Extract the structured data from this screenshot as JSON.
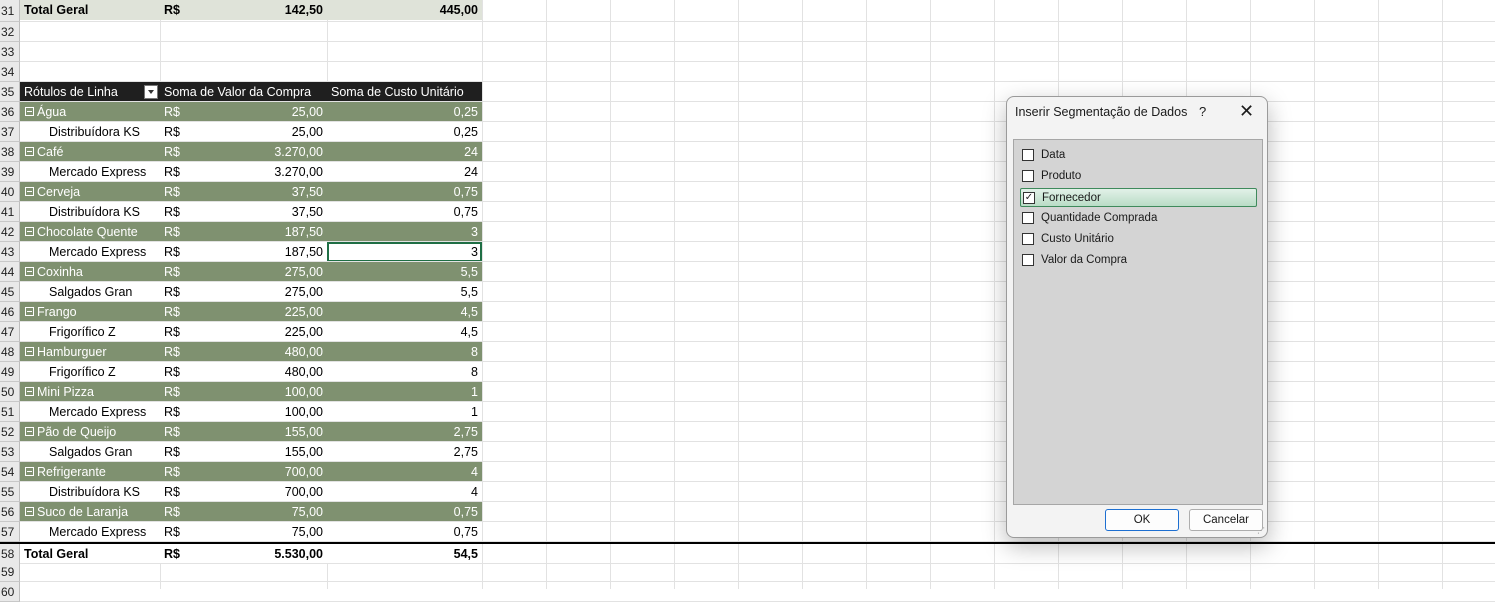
{
  "pivot": {
    "currency": "R$",
    "top_total": {
      "row": "31",
      "label": "Total Geral",
      "value": "142,50",
      "cost": "445,00"
    },
    "empty_rows_top": [
      "32",
      "33",
      "34"
    ],
    "header": {
      "row": "35",
      "col_a": "Rótulos de Linha",
      "col_b": "Soma de Valor da Compra",
      "col_c": "Soma de Custo Unitário"
    },
    "groups": [
      {
        "cat_row": "36",
        "name": "Água",
        "value": "25,00",
        "cost": "0,25",
        "sub_row": "37",
        "sub": "Distribuídora KS",
        "sub_value": "25,00",
        "sub_cost": "0,25"
      },
      {
        "cat_row": "38",
        "name": "Café",
        "value": "3.270,00",
        "cost": "24",
        "sub_row": "39",
        "sub": "Mercado Express",
        "sub_value": "3.270,00",
        "sub_cost": "24"
      },
      {
        "cat_row": "40",
        "name": "Cerveja",
        "value": "37,50",
        "cost": "0,75",
        "sub_row": "41",
        "sub": "Distribuídora KS",
        "sub_value": "37,50",
        "sub_cost": "0,75"
      },
      {
        "cat_row": "42",
        "name": "Chocolate Quente",
        "value": "187,50",
        "cost": "3",
        "sub_row": "43",
        "sub": "Mercado Express",
        "sub_value": "187,50",
        "sub_cost": "3"
      },
      {
        "cat_row": "44",
        "name": "Coxinha",
        "value": "275,00",
        "cost": "5,5",
        "sub_row": "45",
        "sub": "Salgados Gran",
        "sub_value": "275,00",
        "sub_cost": "5,5"
      },
      {
        "cat_row": "46",
        "name": "Frango",
        "value": "225,00",
        "cost": "4,5",
        "sub_row": "47",
        "sub": "Frigorífico Z",
        "sub_value": "225,00",
        "sub_cost": "4,5"
      },
      {
        "cat_row": "48",
        "name": "Hamburguer",
        "value": "480,00",
        "cost": "8",
        "sub_row": "49",
        "sub": "Frigorífico Z",
        "sub_value": "480,00",
        "sub_cost": "8"
      },
      {
        "cat_row": "50",
        "name": "Mini Pizza",
        "value": "100,00",
        "cost": "1",
        "sub_row": "51",
        "sub": "Mercado Express",
        "sub_value": "100,00",
        "sub_cost": "1"
      },
      {
        "cat_row": "52",
        "name": "Pão de Queijo",
        "value": "155,00",
        "cost": "2,75",
        "sub_row": "53",
        "sub": "Salgados Gran",
        "sub_value": "155,00",
        "sub_cost": "2,75"
      },
      {
        "cat_row": "54",
        "name": "Refrigerante",
        "value": "700,00",
        "cost": "4",
        "sub_row": "55",
        "sub": "Distribuídora KS",
        "sub_value": "700,00",
        "sub_cost": "4"
      },
      {
        "cat_row": "56",
        "name": "Suco de Laranja",
        "value": "75,00",
        "cost": "0,75",
        "sub_row": "57",
        "sub": "Mercado Express",
        "sub_value": "75,00",
        "sub_cost": "0,75"
      }
    ],
    "grand_total": {
      "row": "58",
      "label": "Total Geral",
      "value": "5.530,00",
      "cost": "54,5"
    },
    "empty_rows_bottom": [
      "59",
      "60"
    ],
    "selected_row": "43"
  },
  "dialog": {
    "title": "Inserir Segmentação de Dados",
    "help": "?",
    "close": "✕",
    "fields": [
      {
        "label": "Data",
        "checked": false
      },
      {
        "label": "Produto",
        "checked": false
      },
      {
        "label": "Fornecedor",
        "checked": true
      },
      {
        "label": "Quantidade Comprada",
        "checked": false
      },
      {
        "label": "Custo Unitário",
        "checked": false
      },
      {
        "label": "Valor da Compra",
        "checked": false
      }
    ],
    "ok_label": "OK",
    "cancel_label": "Cancelar"
  },
  "colors": {
    "category_row": "#7f9170",
    "header_row": "#1f1f1f",
    "top_total_row": "#dfe3d9",
    "selection": "#1e6e44"
  }
}
